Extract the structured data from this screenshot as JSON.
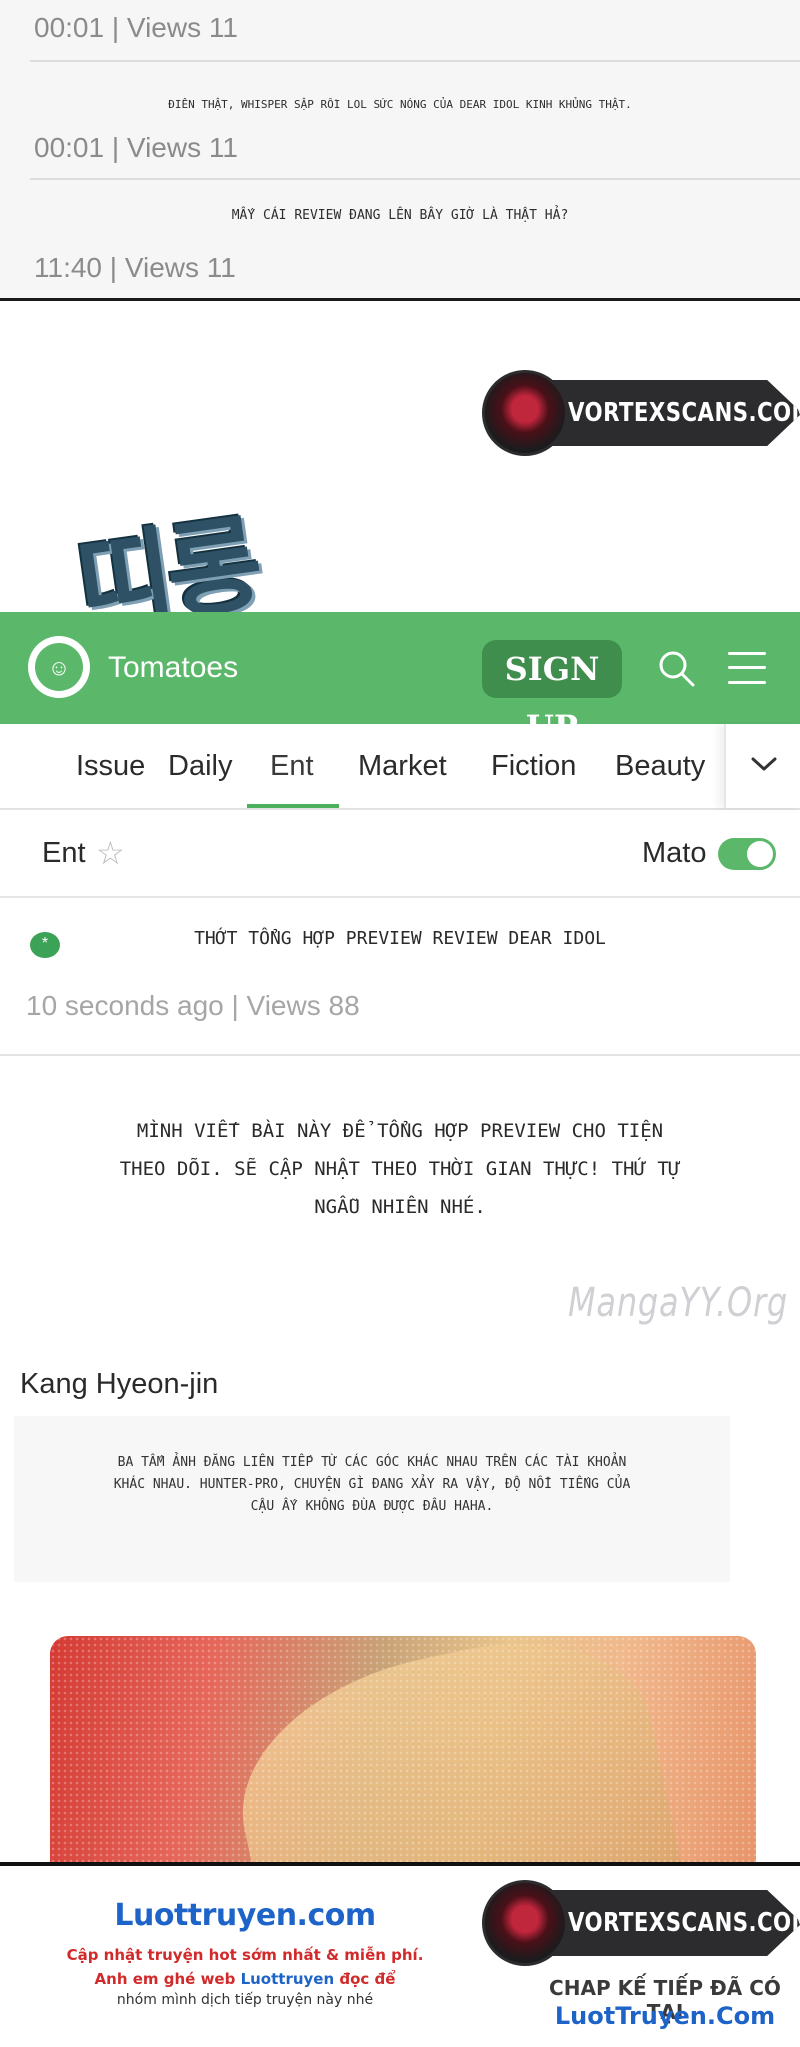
{
  "comments": [
    {
      "text": "",
      "meta": "00:01 | Views 11"
    },
    {
      "text": "Điên thật, whisper sập rồi lol sức nóng của Dear Idol kinh khủng thật.",
      "meta": "00:01 | Views 11"
    },
    {
      "text": "Mấy cái review đang lên bây giờ là thật hả?",
      "meta": "11:40 | Views 11"
    }
  ],
  "badge_text": "VORTEXSCANS.COM",
  "sound_effect": "띠롱",
  "appbar": {
    "brand": "Tomatoes",
    "signup_label": "SIGN UP",
    "search_icon": "search-icon",
    "menu_icon": "hamburger-menu-icon",
    "accent": "#5bb86a"
  },
  "tabs": [
    {
      "label": "Issue"
    },
    {
      "label": "Daily"
    },
    {
      "label": "Ent"
    },
    {
      "label": "Market"
    },
    {
      "label": "Fiction"
    },
    {
      "label": "Beauty"
    }
  ],
  "active_tab": "Ent",
  "subheader": {
    "category": "Ent",
    "favorite_icon": "star-icon",
    "toggle_label": "Mato",
    "toggle_on": true
  },
  "post": {
    "title": "Thớt tổng hợp preview review Dear Idol",
    "meta": "10 seconds ago | Views 88",
    "intro_lines": [
      "Mình viết bài này để tổng hợp preview cho tiện",
      "theo dõi. Sẽ cập nhật theo thời gian thực! Thứ tự",
      "ngẫu nhiên nhé."
    ]
  },
  "watermark": "MangaYY.Org",
  "entry": {
    "author": "Kang Hyeon-jin",
    "quote_lines": [
      "Ba tấm ảnh đăng liên tiếp từ các góc khác nhau trên các tài khoản",
      "khác nhau. Hunter-pro, chuyện gì đang xảy ra vậy, độ nổi tiếng của",
      "cậu ấy không đùa được đâu haha."
    ]
  },
  "footer": {
    "site": "Luottruyen.com",
    "line1": "Cập nhật truyện hot sớm nhất & miễn phí.",
    "line2_prefix": "Anh em ghé web ",
    "line2_link": "Luottruyen",
    "line2_suffix": " đọc để",
    "line3": "nhóm mình dịch tiếp truyện này nhé",
    "right_badge": "VORTEXSCANS.COM",
    "right_line1": "CHAP KẾ TIẾP ĐÃ CÓ TẠI",
    "right_line2": "LuotTruyen.Com"
  }
}
